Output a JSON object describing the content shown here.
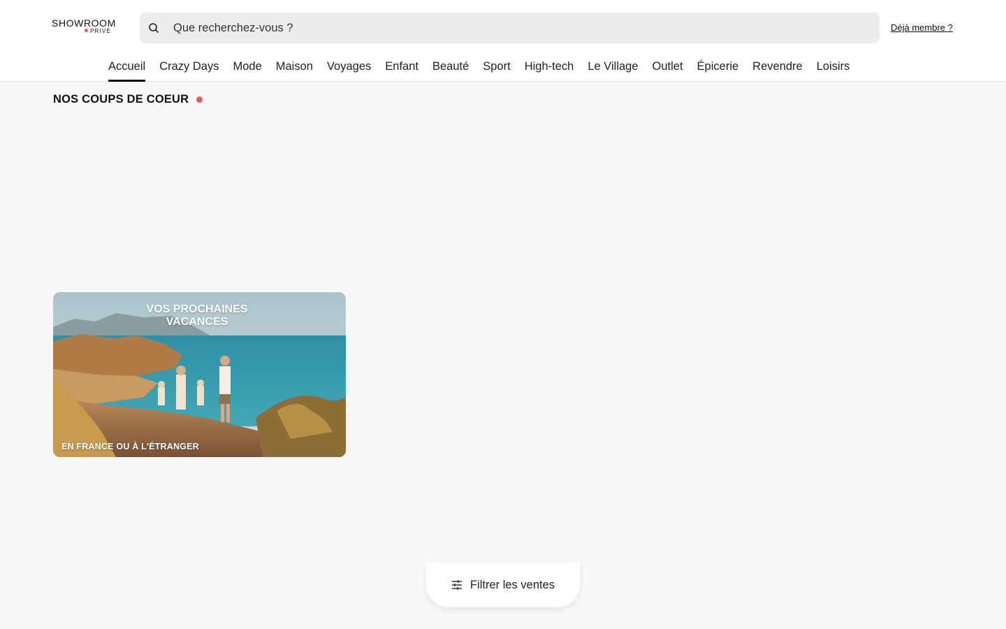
{
  "brand": {
    "name": "SHOWROOM",
    "sub": "PRIVÉ",
    "accent_color": "#e85a5a"
  },
  "search": {
    "placeholder": "Que recherchez-vous ?",
    "icon": "search-icon"
  },
  "header": {
    "member_link": "Déjà membre ?"
  },
  "nav": {
    "items": [
      {
        "label": "Accueil",
        "active": true
      },
      {
        "label": "Crazy Days"
      },
      {
        "label": "Mode"
      },
      {
        "label": "Maison"
      },
      {
        "label": "Voyages"
      },
      {
        "label": "Enfant"
      },
      {
        "label": "Beauté"
      },
      {
        "label": "Sport"
      },
      {
        "label": "High-tech"
      },
      {
        "label": "Le Village"
      },
      {
        "label": "Outlet"
      },
      {
        "label": "Épicerie"
      },
      {
        "label": "Revendre"
      },
      {
        "label": "Loisirs"
      }
    ]
  },
  "section": {
    "title": "NOS COUPS DE COEUR"
  },
  "promo": {
    "title": "VOS PROCHAINES\nVACANCES",
    "subtitle": "EN FRANCE OU À L'ÉTRANGER"
  },
  "filter": {
    "label": "Filtrer les ventes",
    "icon": "sliders-icon"
  }
}
